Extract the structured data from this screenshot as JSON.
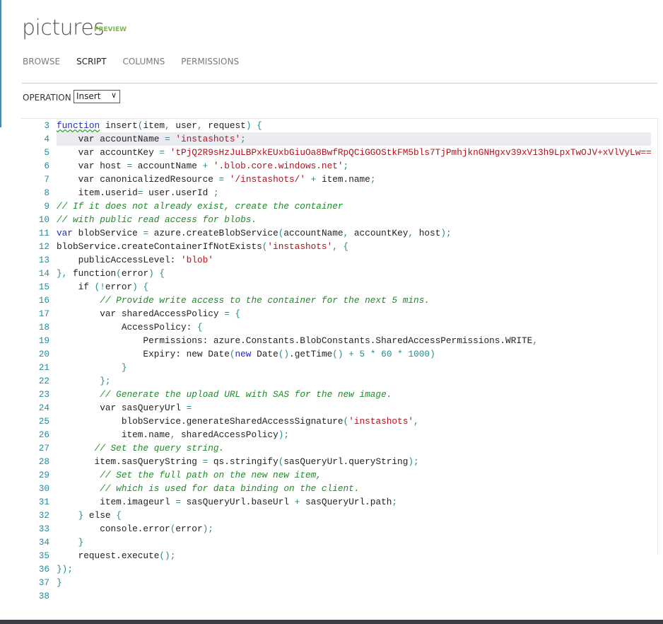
{
  "header": {
    "title": "pictures",
    "badge": "PREVIEW"
  },
  "tabs": [
    {
      "label": "BROWSE",
      "active": false
    },
    {
      "label": "SCRIPT",
      "active": true
    },
    {
      "label": "COLUMNS",
      "active": false
    },
    {
      "label": "PERMISSIONS",
      "active": false
    }
  ],
  "operation": {
    "label": "OPERATION",
    "selected": "Insert",
    "icon": "chevron-down-icon"
  },
  "colors": {
    "keyword": "#1f2dc8",
    "string": "#b0141e",
    "comment": "#1f8a2a",
    "property": "#a0522d",
    "line_number": "#2a8a9a",
    "preview_badge": "#7ab648"
  },
  "editor": {
    "highlighted_line": 4,
    "lines": [
      {
        "n": "3",
        "text": "function insert(item, user, request) {"
      },
      {
        "n": "4",
        "text": "    var accountName = 'instashots';"
      },
      {
        "n": "5",
        "text": "    var accountKey = 'tPjQ2R9sHzJuLBPxkEUxbGiuOa8BwfRpQCiGGOStkFM5bls7TjPmhjknGNHgxv39xV13h9LpxTwOJV+xVlVyLw=="
      },
      {
        "n": "6",
        "text": "    var host = accountName + '.blob.core.windows.net';"
      },
      {
        "n": "7",
        "text": "    var canonicalizedResource = '/instashots/' + item.name;"
      },
      {
        "n": "8",
        "text": "    item.userid= user.userId ;"
      },
      {
        "n": "9",
        "text": "// If it does not already exist, create the container"
      },
      {
        "n": "10",
        "text": "// with public read access for blobs."
      },
      {
        "n": "11",
        "text": "var blobService = azure.createBlobService(accountName, accountKey, host);"
      },
      {
        "n": "12",
        "text": "blobService.createContainerIfNotExists('instashots', {"
      },
      {
        "n": "13",
        "text": "    publicAccessLevel: 'blob'"
      },
      {
        "n": "14",
        "text": "}, function(error) {"
      },
      {
        "n": "15",
        "text": "    if (!error) {"
      },
      {
        "n": "16",
        "text": "        // Provide write access to the container for the next 5 mins."
      },
      {
        "n": "17",
        "text": "        var sharedAccessPolicy = {"
      },
      {
        "n": "18",
        "text": "            AccessPolicy: {"
      },
      {
        "n": "19",
        "text": "                Permissions: azure.Constants.BlobConstants.SharedAccessPermissions.WRITE,"
      },
      {
        "n": "20",
        "text": "                Expiry: new Date(new Date().getTime() + 5 * 60 * 1000)"
      },
      {
        "n": "21",
        "text": "            }"
      },
      {
        "n": "22",
        "text": "        };"
      },
      {
        "n": "23",
        "text": "        // Generate the upload URL with SAS for the new image."
      },
      {
        "n": "24",
        "text": "        var sasQueryUrl ="
      },
      {
        "n": "25",
        "text": "            blobService.generateSharedAccessSignature('instashots',"
      },
      {
        "n": "26",
        "text": "            item.name, sharedAccessPolicy);"
      },
      {
        "n": "27",
        "text": "       // Set the query string."
      },
      {
        "n": "28",
        "text": "       item.sasQueryString = qs.stringify(sasQueryUrl.queryString);"
      },
      {
        "n": "29",
        "text": "        // Set the full path on the new new item,"
      },
      {
        "n": "30",
        "text": "        // which is used for data binding on the client."
      },
      {
        "n": "31",
        "text": "        item.imageurl = sasQueryUrl.baseUrl + sasQueryUrl.path;"
      },
      {
        "n": "32",
        "text": "    } else {"
      },
      {
        "n": "33",
        "text": "        console.error(error);"
      },
      {
        "n": "34",
        "text": "    }"
      },
      {
        "n": "35",
        "text": "    request.execute();"
      },
      {
        "n": "36",
        "text": "});"
      },
      {
        "n": "37",
        "text": "}"
      },
      {
        "n": "38",
        "text": ""
      }
    ]
  }
}
